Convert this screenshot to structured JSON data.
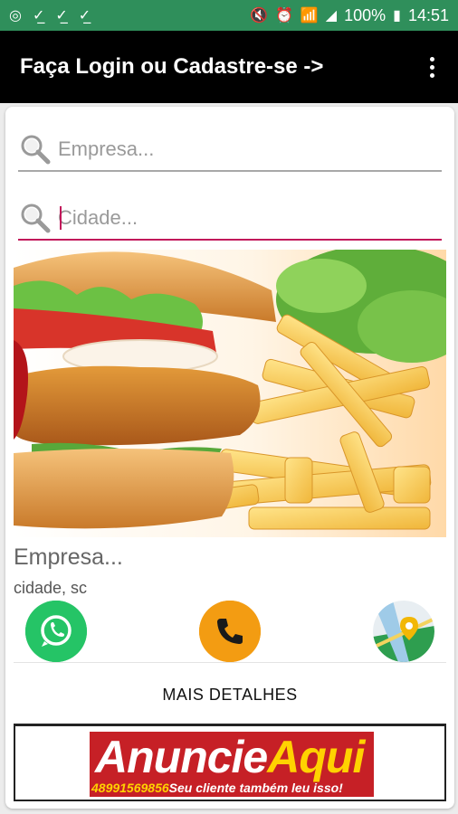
{
  "status_bar": {
    "battery": "100%",
    "time": "14:51",
    "color": "#2f8f5b"
  },
  "toolbar": {
    "title": "Faça Login ou Cadastre-se ->",
    "menu_icon": "more-vert-icon"
  },
  "search": {
    "empresa_placeholder": "Empresa...",
    "cidade_placeholder": "Cidade...",
    "empresa_value": "",
    "cidade_value": "",
    "icon": "magnifier-icon",
    "active_color": "#c2185b"
  },
  "listing": {
    "image_alt": "burger and fries",
    "company_name": "Empresa...",
    "city": "cidade, sc",
    "actions": [
      {
        "name": "whatsapp",
        "icon": "whatsapp-icon",
        "color": "#25c466"
      },
      {
        "name": "phone",
        "icon": "phone-icon",
        "color": "#f39c12"
      },
      {
        "name": "map",
        "icon": "map-pin-icon",
        "color": "#2e9e4f"
      }
    ],
    "details_label": "MAIS DETALHES"
  },
  "ad": {
    "headline_1": "Anuncie",
    "headline_2": "Aqui",
    "phone": "48991569856",
    "tagline": "Seu cliente também leu isso!",
    "bg_color": "#c62026",
    "accent_color": "#ffd200"
  }
}
